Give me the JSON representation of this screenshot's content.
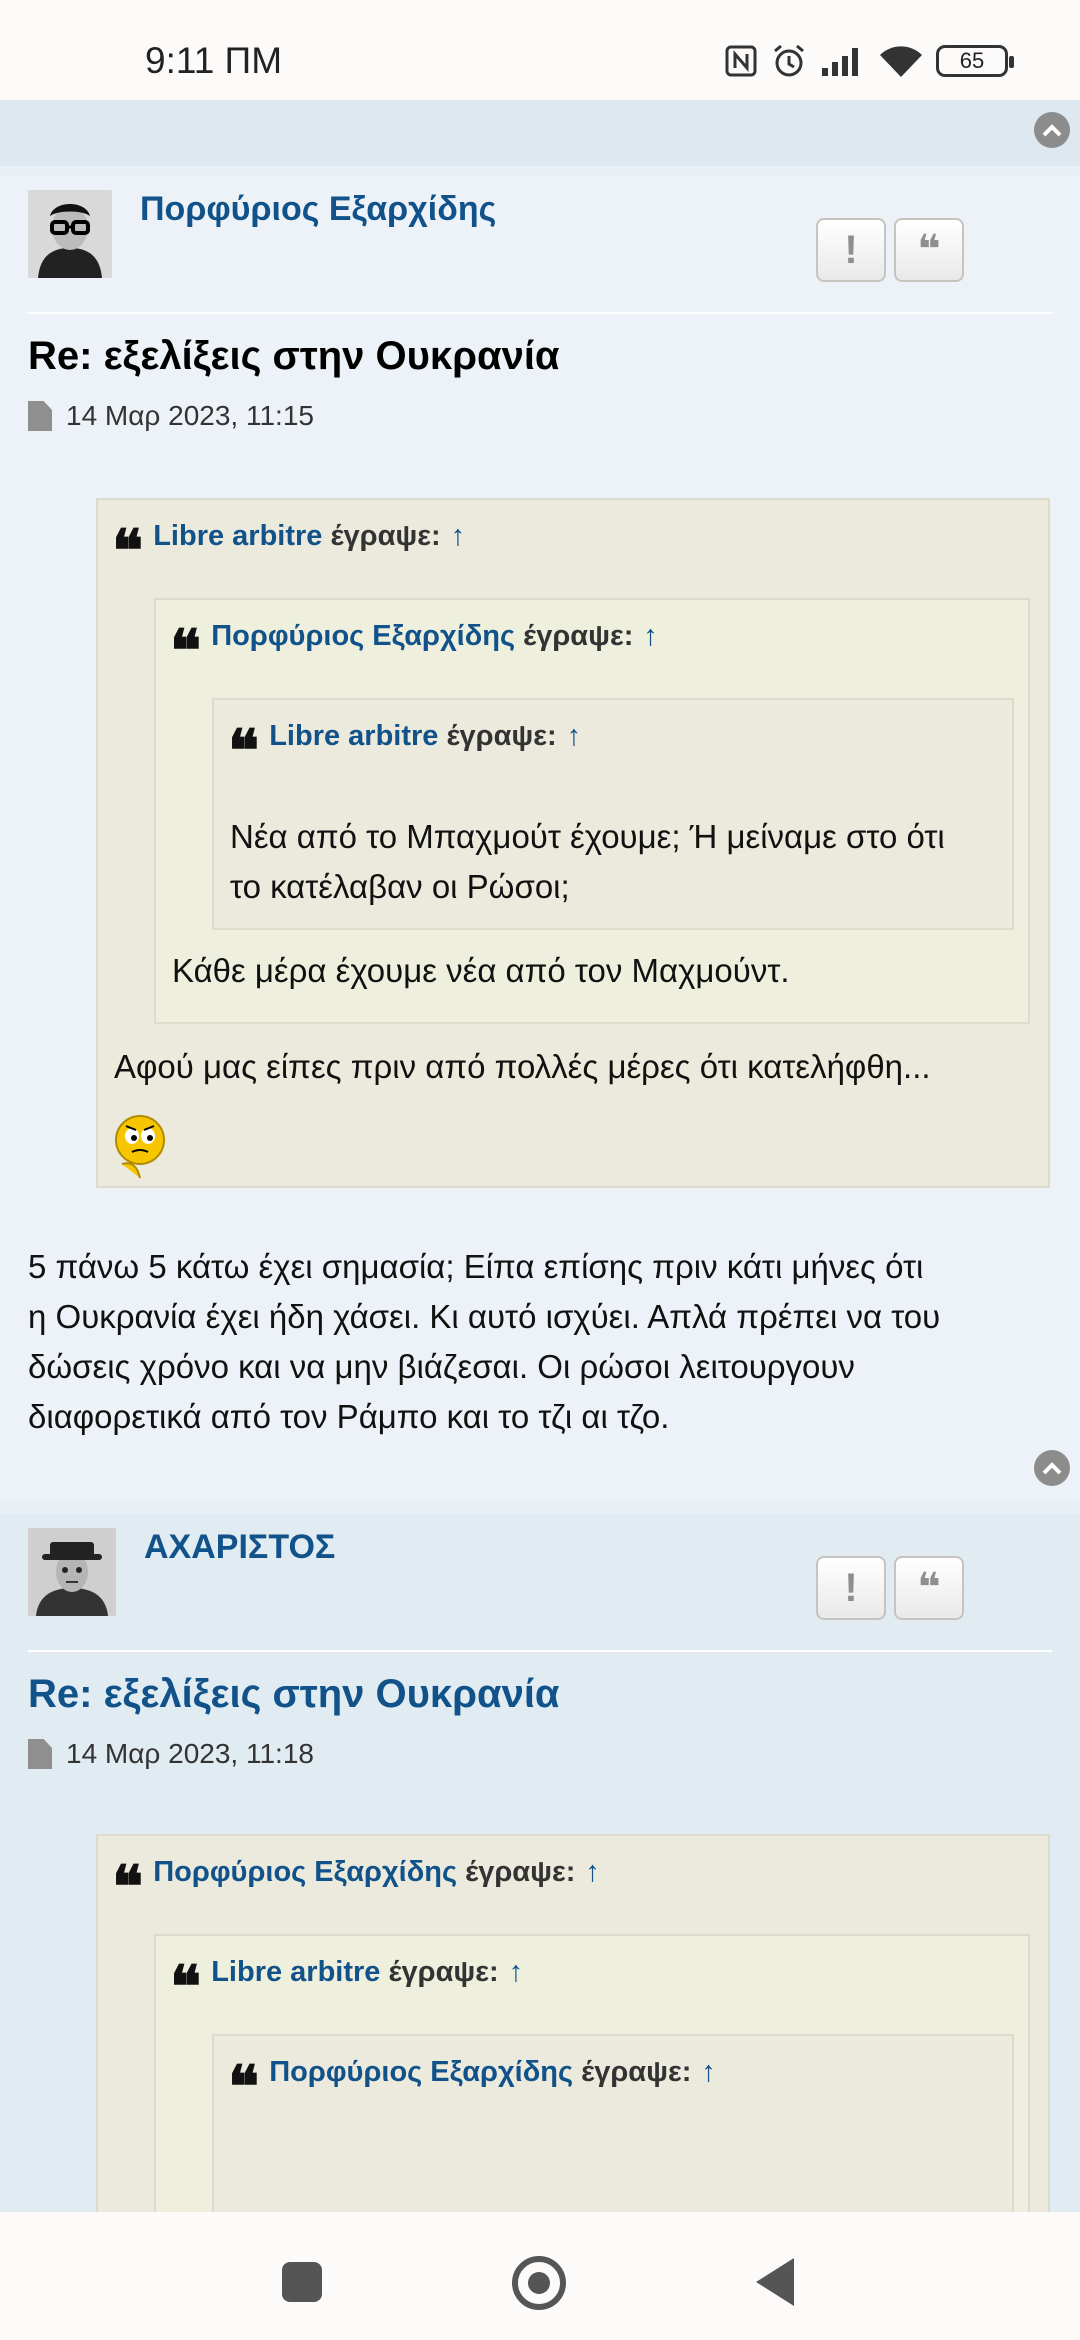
{
  "status_bar": {
    "time": "9:11 ΠΜ",
    "battery": "65"
  },
  "posts": [
    {
      "author": "Πορφύριος Εξαρχίδης",
      "title": "Re: εξελίξεις στην Ουκρανία",
      "date": "14 Μαρ 2023, 11:15",
      "report_label": "!",
      "quote_label": "❝",
      "quote": {
        "author": "Libre arbitre",
        "wrote": "έγραψε:",
        "arrow": "↑",
        "nested": {
          "author": "Πορφύριος Εξαρχίδης",
          "wrote": "έγραψε:",
          "arrow": "↑",
          "nested": {
            "author": "Libre arbitre",
            "wrote": "έγραψε:",
            "arrow": "↑",
            "text_line1": "Νέα από το Μπαχμούτ έχουμε; Ή μείναμε στο ότι",
            "text_line2": "το κατέλαβαν οι Ρώσοι;"
          },
          "text": "Κάθε μέρα έχουμε νέα από τον Μαχμούντ."
        },
        "text": "Αφού μας είπες πριν από πολλές μέρες ότι κατελήφθη..."
      },
      "body_lines": [
        "5 πάνω 5 κάτω έχει σημασία; Είπα επίσης πριν κάτι μήνες ότι",
        "η Ουκρανία έχει ήδη χάσει. Κι αυτό ισχύει. Απλά πρέπει να του",
        "δώσεις χρόνο και να μην βιάζεσαι. Οι ρώσοι λειτουργουν",
        "διαφορετικά από τον Ράμπο και το τζι αι τζο."
      ]
    },
    {
      "author": "ΑΧΑΡΙΣΤΟΣ",
      "title": "Re: εξελίξεις στην Ουκρανία",
      "date": "14 Μαρ 2023, 11:18",
      "report_label": "!",
      "quote_label": "❝",
      "quote": {
        "author": "Πορφύριος Εξαρχίδης",
        "wrote": "έγραψε:",
        "arrow": "↑",
        "nested": {
          "author": "Libre arbitre",
          "wrote": "έγραψε:",
          "arrow": "↑",
          "nested": {
            "author": "Πορφύριος Εξαρχίδης",
            "wrote": "έγραψε:",
            "arrow": "↑"
          }
        }
      }
    }
  ],
  "colors": {
    "link": "#105289",
    "quote_bg": "#ebeadd",
    "post_bg": "#ecf2f7"
  }
}
